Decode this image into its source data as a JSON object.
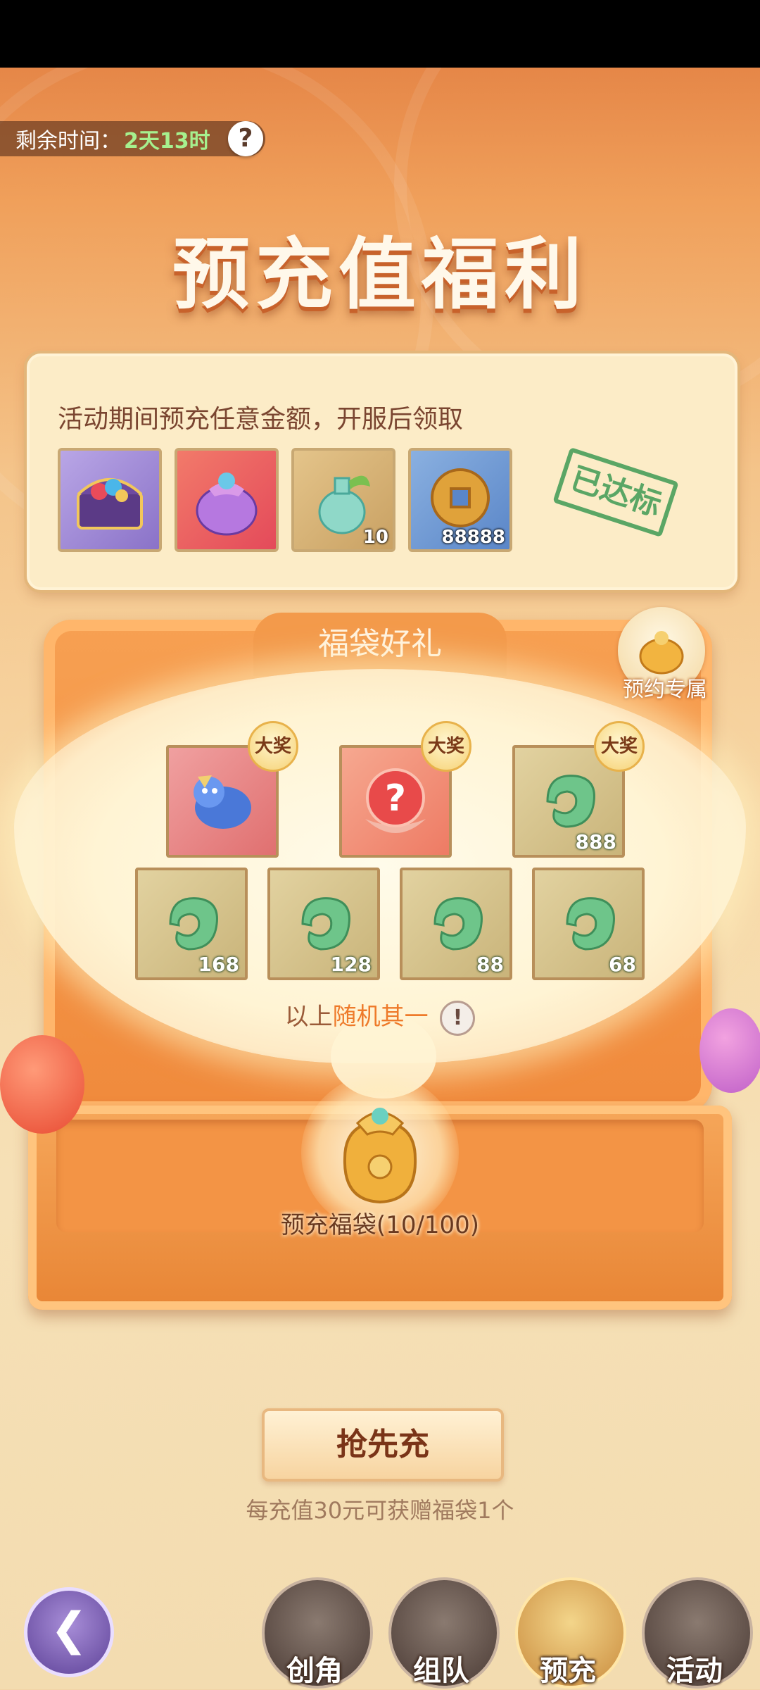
{
  "timer": {
    "label": "剩余时间：",
    "value": "2天13时"
  },
  "header": {
    "title": "预充值福利"
  },
  "prerecharge_card": {
    "description": "活动期间预充任意金额，开服后领取",
    "items": [
      {
        "name": "treasure-chest-icon",
        "qty": ""
      },
      {
        "name": "lucky-bag-icon",
        "qty": ""
      },
      {
        "name": "potion-bottle-icon",
        "qty": "10"
      },
      {
        "name": "copper-coin-icon",
        "qty": "88888"
      }
    ],
    "stamp": "已达标"
  },
  "lucky_bag": {
    "title": "福袋好礼",
    "reserve_label": "预约专属",
    "grand_badge": "大奖",
    "top_prizes": [
      {
        "name": "ice-beast-icon",
        "qty": "",
        "grand": true
      },
      {
        "name": "mystery-orb-icon",
        "qty": "",
        "grand": true
      },
      {
        "name": "jade-icon",
        "qty": "888",
        "grand": true
      }
    ],
    "bottom_prizes": [
      {
        "name": "jade-icon",
        "qty": "168"
      },
      {
        "name": "jade-icon",
        "qty": "128"
      },
      {
        "name": "jade-icon",
        "qty": "88"
      },
      {
        "name": "jade-icon",
        "qty": "68"
      }
    ],
    "random_note_prefix": "以上",
    "random_note_highlight": "随机其一",
    "bag_label": "预充福袋(10/100)"
  },
  "cta": {
    "label": "抢先充",
    "note": "每充值30元可获赠福袋1个"
  },
  "bottom_nav": [
    {
      "label": "创角",
      "active": false
    },
    {
      "label": "组队",
      "active": false
    },
    {
      "label": "预充",
      "active": true
    },
    {
      "label": "活动",
      "active": false
    }
  ],
  "colors": {
    "accent": "#ee7a2a",
    "timer_value": "#a6f08e",
    "stamp": "#3e9a55"
  }
}
